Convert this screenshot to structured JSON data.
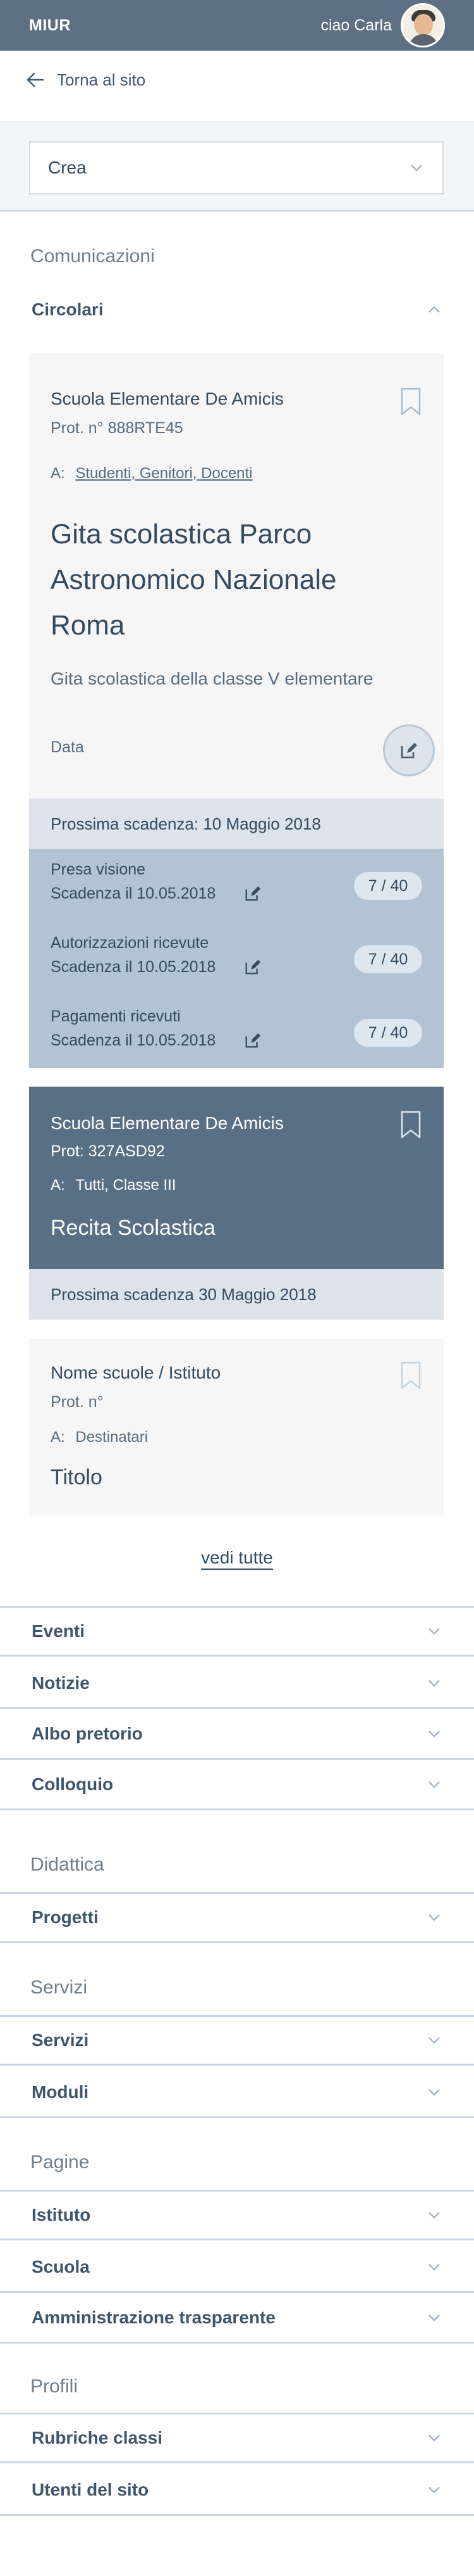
{
  "topbar": {
    "brand": "MIUR",
    "greeting": "ciao Carla"
  },
  "back_link": "Torna al sito",
  "crea": {
    "selected": "Crea"
  },
  "sections": {
    "comunicazioni": "Comunicazioni",
    "didattica": "Didattica",
    "servizi": "Servizi",
    "pagine": "Pagine",
    "profili": "Profili"
  },
  "circolari": {
    "label": "Circolari",
    "cards": [
      {
        "school": "Scuola Elementare De Amicis",
        "prot": "Prot. n° 888RTE45",
        "to_label": "A:",
        "to": "Studenti, Genitori, Docenti",
        "title": "Gita scolastica Parco Astronomico Nazionale Roma",
        "description": "Gita scolastica della classe V elementare",
        "data_label": "Data",
        "deadline": "Prossima scadenza: 10 Maggio 2018",
        "tasks": [
          {
            "name": "Presa visione",
            "date": "Scadenza il 10.05.2018",
            "count": "7 / 40"
          },
          {
            "name": "Autorizzazioni ricevute",
            "date": "Scadenza il 10.05.2018",
            "count": "7 / 40"
          },
          {
            "name": "Pagamenti ricevuti",
            "date": "Scadenza il 10.05.2018",
            "count": "7 / 40"
          }
        ]
      },
      {
        "school": "Scuola Elementare De Amicis",
        "prot": "Prot: 327ASD92",
        "to_label": "A:",
        "to": "Tutti, Classe III",
        "title": "Recita Scolastica",
        "deadline": "Prossima scadenza 30 Maggio 2018"
      },
      {
        "school": "Nome scuole / Istituto",
        "prot": "Prot. n°",
        "to_label": "A:",
        "to": "Destinatari",
        "title": "Titolo"
      }
    ],
    "see_all": "vedi tutte"
  },
  "menu": {
    "comunicazioni": [
      "Eventi",
      "Notizie",
      "Albo pretorio",
      "Colloquio"
    ],
    "didattica": [
      "Progetti"
    ],
    "servizi": [
      "Servizi",
      "Moduli"
    ],
    "pagine": [
      "Istituto",
      "Scuola",
      "Amministrazione trasparente"
    ],
    "profili": [
      "Rubriche classi",
      "Utenti del sito"
    ]
  },
  "icons": {
    "back": "arrow-left-icon",
    "chevron_down": "chevron-down-icon",
    "chevron_up": "chevron-up-icon",
    "bookmark": "bookmark-icon",
    "edit": "edit-icon",
    "avatar": "user-avatar"
  },
  "colors": {
    "topbar": "#5d7083",
    "accent_card": "#587086",
    "tasks_bg": "#b2c4d4",
    "text": "#435a70"
  }
}
